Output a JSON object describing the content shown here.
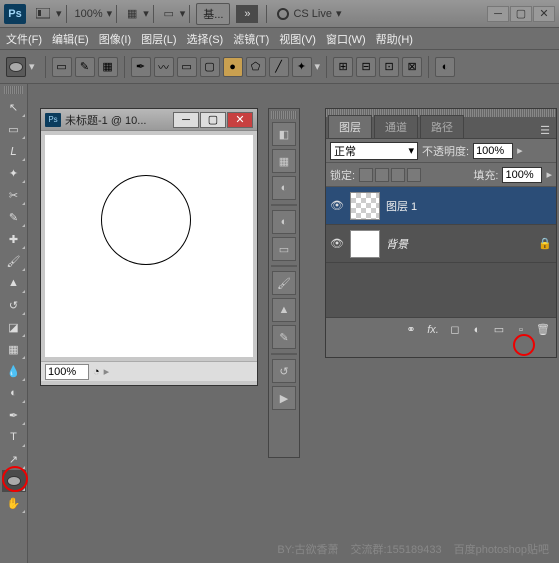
{
  "top": {
    "ps": "Ps",
    "zoom": "100%",
    "basic": "基...",
    "cslive": "CS Live"
  },
  "menu": {
    "file": "文件(F)",
    "edit": "编辑(E)",
    "image": "图像(I)",
    "layer": "图层(L)",
    "select": "选择(S)",
    "filter": "滤镜(T)",
    "view": "视图(V)",
    "window": "窗口(W)",
    "help": "帮助(H)"
  },
  "doc": {
    "title": "未标题-1 @ 10...",
    "zoom": "100%"
  },
  "layers": {
    "tabs": {
      "layers": "图层",
      "channels": "通道",
      "paths": "路径"
    },
    "blend": "正常",
    "opacity_lbl": "不透明度:",
    "opacity": "100%",
    "lock_lbl": "锁定:",
    "fill_lbl": "填充:",
    "fill": "100%",
    "items": [
      {
        "name": "图层 1"
      },
      {
        "name": "背景"
      }
    ]
  },
  "footer": {
    "by": "BY:古欲香萧",
    "qq": "交流群:155189433",
    "baidu": "百度photoshop贴吧"
  }
}
